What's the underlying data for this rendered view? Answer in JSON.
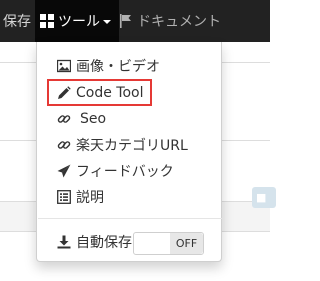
{
  "navbar": {
    "save_label": "保存",
    "tools_label": "ツール",
    "docs_label": "ドキュメント"
  },
  "tools_menu": {
    "items": [
      {
        "label": "画像・ビデオ",
        "icon": "image-icon"
      },
      {
        "label": "Code Tool",
        "icon": "pencil-icon"
      },
      {
        "label": "Seo",
        "icon": "link-icon"
      },
      {
        "label": "楽天カテゴリURL",
        "icon": "link-icon"
      },
      {
        "label": "フィードバック",
        "icon": "send-icon"
      },
      {
        "label": "説明",
        "icon": "list-icon"
      }
    ],
    "autosave_label": "自動保存",
    "autosave_state": "OFF"
  },
  "colors": {
    "navbar_bg": "#222222",
    "active_tab_bg": "#080808",
    "highlight_border": "#e53935"
  }
}
